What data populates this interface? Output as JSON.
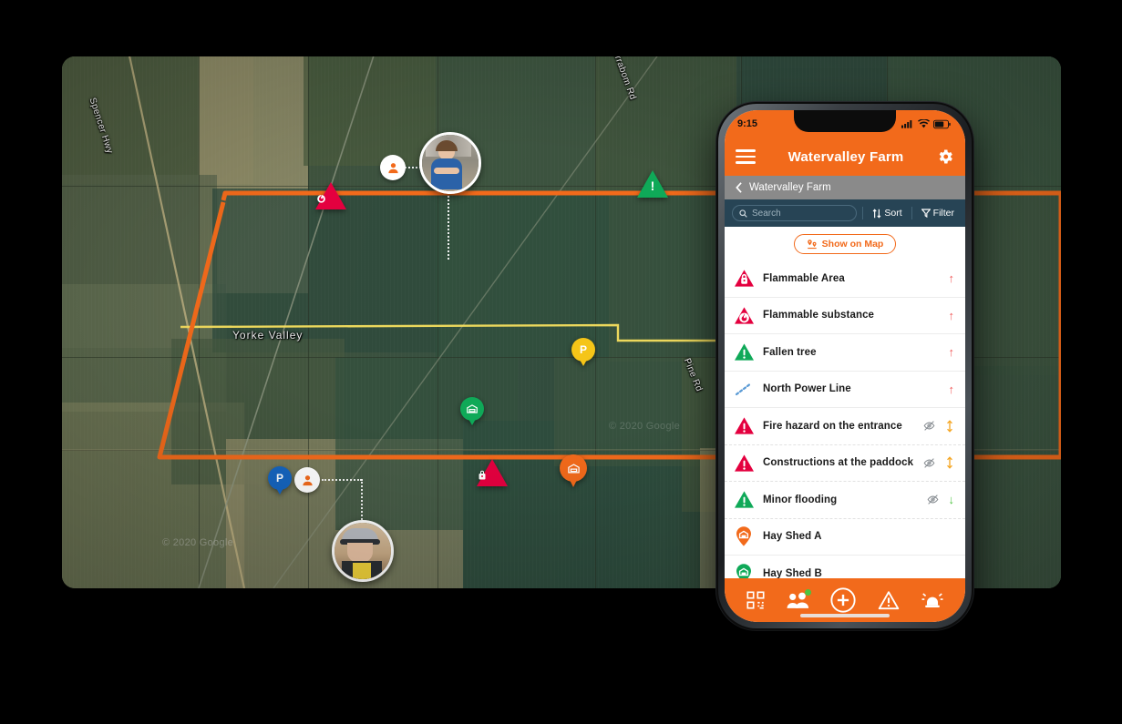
{
  "colors": {
    "brand_orange": "#F26A1B",
    "danger_red": "#E4003F",
    "success_green": "#0FA958",
    "dark_navy": "#274455",
    "breadcrumb_grey": "#8A8A8A",
    "power_line_blue": "#5B9BD5",
    "parking_blue": "#1565C0",
    "parcel_yellow": "#F2D024",
    "badge_green": "#4CC23F"
  },
  "phone": {
    "status": {
      "time": "9:15",
      "cellular_icon": "signal-bars-icon",
      "wifi_icon": "wifi-icon",
      "battery_icon": "battery-icon"
    },
    "appbar": {
      "menu_icon": "hamburger-menu-icon",
      "title": "Watervalley Farm",
      "settings_icon": "gear-icon"
    },
    "breadcrumb": {
      "back_icon": "chevron-left-icon",
      "label": "Watervalley Farm"
    },
    "search": {
      "icon": "search-icon",
      "value": "",
      "placeholder": "Search",
      "sort_label": "Sort",
      "sort_icon": "sort-icon",
      "filter_label": "Filter",
      "filter_icon": "filter-icon"
    },
    "show_on_map": {
      "label": "Show on Map",
      "icon": "map-pins-icon"
    },
    "list": [
      {
        "label": "Flammable Area",
        "icon": "flammable-area-triangle-icon",
        "icon_color": "#E4003F",
        "actions": [
          "arrow-up-red"
        ]
      },
      {
        "label": "Flammable substance",
        "icon": "flammable-substance-triangle-icon",
        "icon_color": "#E4003F",
        "actions": [
          "arrow-up-red"
        ]
      },
      {
        "label": "Fallen tree",
        "icon": "warning-triangle-green-icon",
        "icon_color": "#0FA958",
        "actions": [
          "arrow-up-red"
        ]
      },
      {
        "label": "North Power Line",
        "icon": "dashed-power-line-icon",
        "icon_color": "#5B9BD5",
        "actions": [
          "arrow-up-red"
        ]
      },
      {
        "label": "Fire hazard on the entrance",
        "icon": "warning-triangle-red-icon",
        "icon_color": "#E4003F",
        "actions": [
          "eye-off-grey",
          "arrow-up-down-orange"
        ]
      },
      {
        "label": "Constructions at the paddock",
        "icon": "warning-triangle-red-icon",
        "icon_color": "#E4003F",
        "actions": [
          "eye-off-grey",
          "arrow-up-down-orange"
        ]
      },
      {
        "label": "Minor flooding",
        "icon": "warning-triangle-green-icon",
        "icon_color": "#0FA958",
        "actions": [
          "eye-off-grey",
          "arrow-down-green"
        ]
      },
      {
        "label": "Hay Shed A",
        "icon": "shed-pin-orange-icon",
        "icon_color": "#F26A1B",
        "actions": []
      },
      {
        "label": "Hay Shed B",
        "icon": "shed-pin-green-icon",
        "icon_color": "#0FA958",
        "actions": []
      }
    ],
    "tabbar": [
      {
        "name": "qr-code-icon",
        "label": ""
      },
      {
        "name": "people-group-icon",
        "label": "",
        "badge": true
      },
      {
        "name": "add-plus-icon",
        "label": ""
      },
      {
        "name": "warning-triangle-icon",
        "label": ""
      },
      {
        "name": "siren-alarm-icon",
        "label": ""
      }
    ]
  },
  "map": {
    "road_labels": [
      {
        "text": "Spencer Hwy"
      },
      {
        "text": "Wirrabom Rd"
      },
      {
        "text": "Pine Rd"
      }
    ],
    "place_labels": [
      {
        "text": "Yorke Valley"
      }
    ],
    "attribution": "© 2020 Google",
    "attribution2": "© 2020 Google",
    "markers": [
      {
        "name": "avatar-marker-worker-female",
        "type": "avatar"
      },
      {
        "name": "avatar-marker-worker-male",
        "type": "avatar"
      },
      {
        "name": "person-marker-top",
        "type": "circle-person"
      },
      {
        "name": "person-marker-bottom",
        "type": "circle-person"
      },
      {
        "name": "flammable-substance-marker",
        "type": "triangle-red",
        "glyph": "flame"
      },
      {
        "name": "fallen-tree-marker",
        "type": "triangle-green",
        "glyph": "!"
      },
      {
        "name": "flammable-area-marker",
        "type": "triangle-red",
        "glyph": "lock"
      },
      {
        "name": "parking-marker",
        "type": "pin-blue",
        "glyph": "P"
      },
      {
        "name": "paddock-marker",
        "type": "pin-yellow",
        "glyph": "P"
      },
      {
        "name": "hay-shed-b-marker",
        "type": "pin-green",
        "glyph": "shed"
      },
      {
        "name": "hay-shed-a-marker",
        "type": "pin-orange",
        "glyph": "shed"
      }
    ]
  }
}
